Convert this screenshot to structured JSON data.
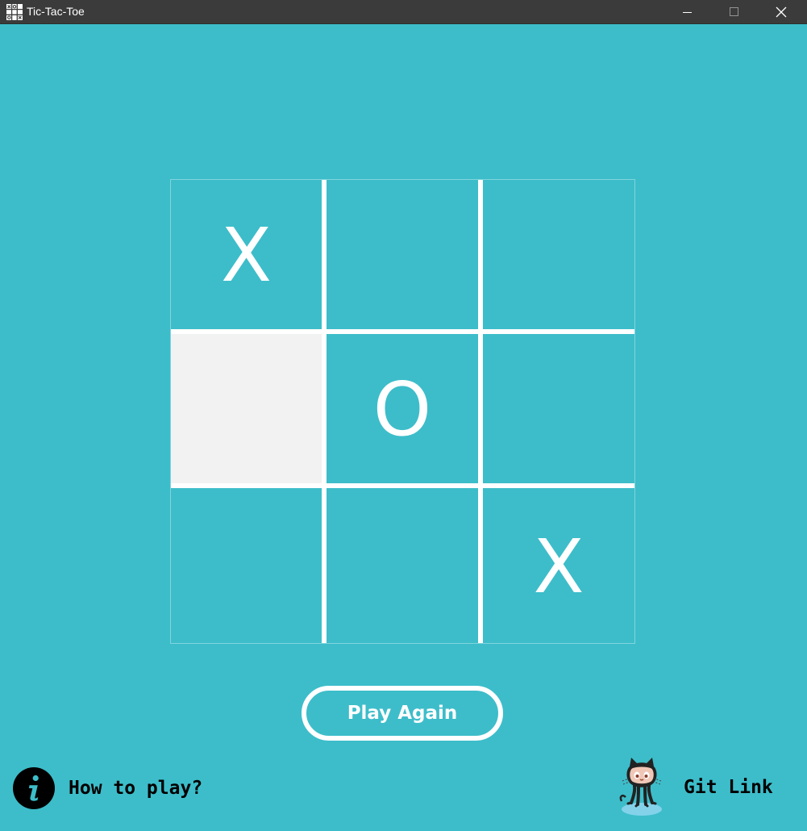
{
  "window": {
    "title": "Tic-Tac-Toe"
  },
  "board": {
    "cells": [
      [
        "X",
        "",
        ""
      ],
      [
        "",
        "O",
        ""
      ],
      [
        "",
        "",
        "X"
      ]
    ],
    "highlighted_cell": {
      "row": 1,
      "col": 0
    }
  },
  "controls": {
    "play_again_label": "Play Again",
    "how_to_play_label": "How to play?",
    "git_link_label": "Git Link"
  },
  "icons": {
    "app": "tic-tac-toe-icon",
    "info": "info-icon",
    "github": "octocat-icon",
    "minimize": "minimize-icon",
    "maximize": "maximize-icon",
    "close": "close-icon"
  },
  "colors": {
    "background": "#3dbdca",
    "titlebar": "#3b3b3b",
    "grid": "#ffffff",
    "highlight": "#f2f2f2",
    "text": "#ffffff",
    "footer_text": "#000000"
  }
}
